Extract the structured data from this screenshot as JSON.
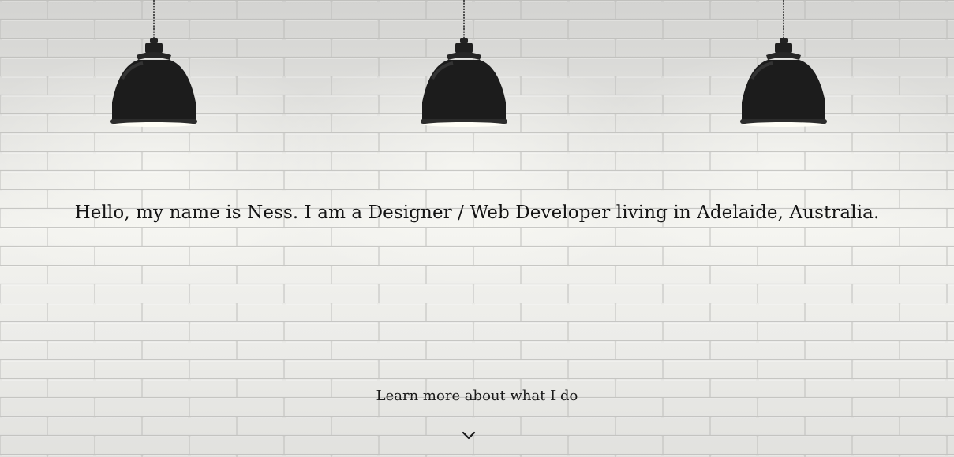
{
  "hero": {
    "tagline": "Hello, my name is Ness. I am a Designer / Web Developer living in Adelaide, Australia.",
    "cta_label": "Learn more about what I do",
    "cta_icon": "chevron-down-icon",
    "background": "whitewashed-brick-wall",
    "lamps": [
      "pendant-lamp-icon",
      "pendant-lamp-icon",
      "pendant-lamp-icon"
    ]
  },
  "colors": {
    "text": "#141414",
    "lamp": "#1e1e1e",
    "wall": "#e6e6e4"
  }
}
